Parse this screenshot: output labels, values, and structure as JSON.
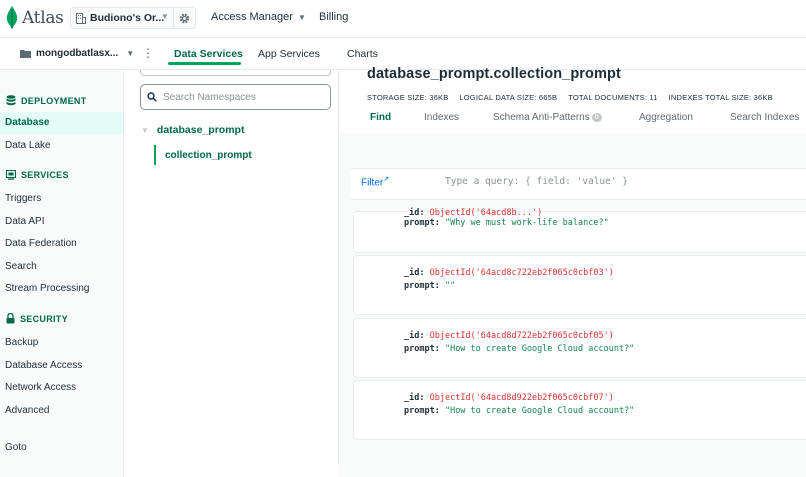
{
  "topbar": {
    "logo_text": "Atlas",
    "org_name": "Budiono's Or...",
    "access_manager": "Access Manager",
    "billing": "Billing"
  },
  "subbar": {
    "project_name": "mongodbatlasx...",
    "tabs": [
      "Data Services",
      "App Services",
      "Charts"
    ],
    "active_tab": "Data Services"
  },
  "leftnav": {
    "deployment": {
      "heading": "DEPLOYMENT",
      "items": [
        "Database",
        "Data Lake"
      ]
    },
    "services": {
      "heading": "SERVICES",
      "items": [
        "Triggers",
        "Data API",
        "Data Federation",
        "Search",
        "Stream Processing"
      ]
    },
    "security": {
      "heading": "SECURITY",
      "items": [
        "Backup",
        "Database Access",
        "Network Access",
        "Advanced"
      ]
    },
    "goto": "Goto",
    "active_item": "Database"
  },
  "namespaces": {
    "search_placeholder": "Search Namespaces",
    "database": "database_prompt",
    "collection": "collection_prompt"
  },
  "collection": {
    "title": "database_prompt.collection_prompt",
    "stats": [
      "STORAGE SIZE: 36KB",
      "LOGICAL DATA SIZE: 665B",
      "TOTAL DOCUMENTS: 11",
      "INDEXES TOTAL SIZE: 36KB"
    ],
    "tabs": [
      {
        "label": "Find",
        "badge": ""
      },
      {
        "label": "Indexes",
        "badge": ""
      },
      {
        "label": "Schema Anti-Patterns",
        "badge": "0"
      },
      {
        "label": "Aggregation",
        "badge": ""
      },
      {
        "label": "Search Indexes",
        "badge": ""
      }
    ],
    "active_tab": "Find"
  },
  "filter": {
    "label": "Filter",
    "placeholder": "Type a query: { field: 'value' }"
  },
  "documents": [
    {
      "id_key": "_id:",
      "id_value": "ObjectId('64acd8b...')",
      "prompt_key": "prompt:",
      "prompt_value": "\"Why we must work-life balance?\""
    },
    {
      "id_key": "_id:",
      "id_value": "ObjectId('64acd8c722eb2f065c0cbf03')",
      "prompt_key": "prompt:",
      "prompt_value": "\"\""
    },
    {
      "id_key": "_id:",
      "id_value": "ObjectId('64acd8d722eb2f065c0cbf05')",
      "prompt_key": "prompt:",
      "prompt_value": "\"How to create Google Cloud account?\""
    },
    {
      "id_key": "_id:",
      "id_value": "ObjectId('64acd8d922eb2f065c0cbf07')",
      "prompt_key": "prompt:",
      "prompt_value": "\"How to create Google Cloud account?\""
    }
  ],
  "colors": {
    "brand_green": "#00684a",
    "accent_green": "#00a35c",
    "link_blue": "#016bf8",
    "objectid_red": "#db3030",
    "string_green": "#12824d"
  }
}
